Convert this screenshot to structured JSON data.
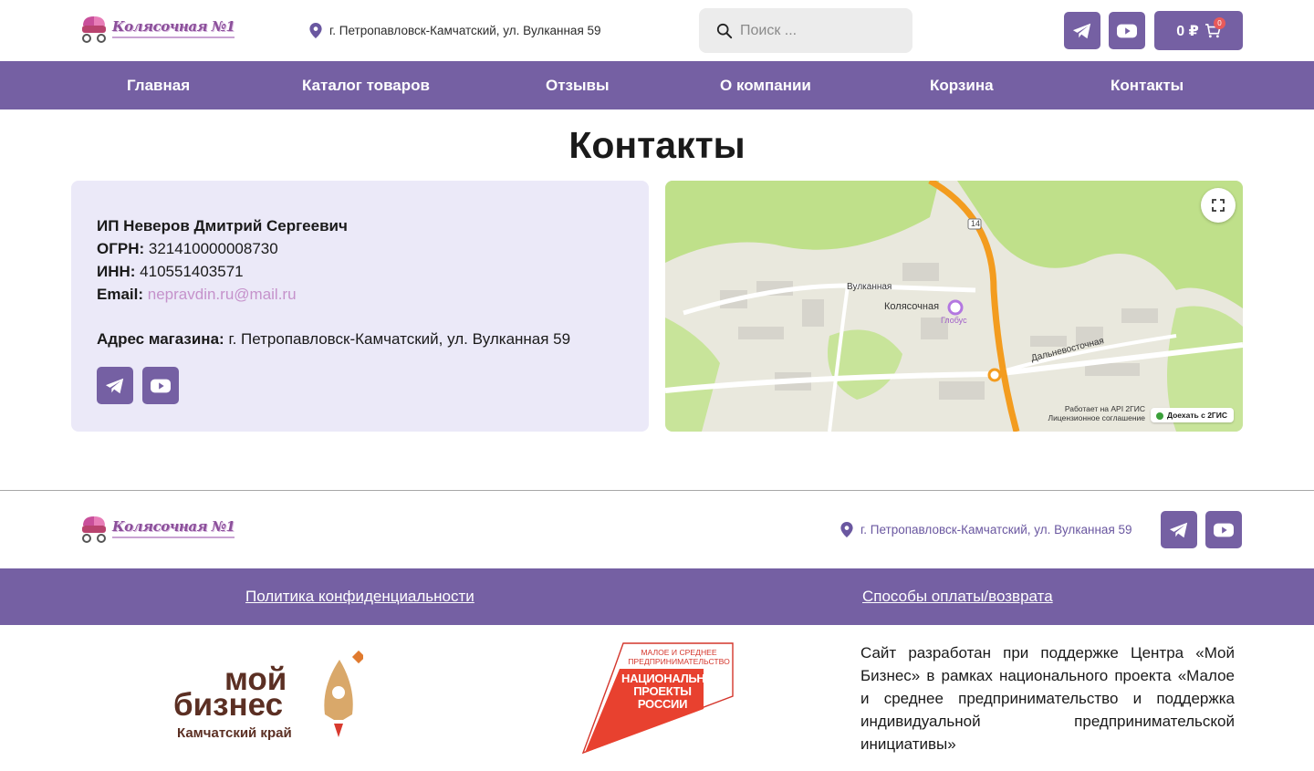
{
  "header": {
    "logo_text": "Колясочная №1",
    "address": "г. Петропавловск-Камчатский, ул. Вулканная 59",
    "search_placeholder": "Поиск ...",
    "cart": {
      "total": "0 ₽",
      "count": "0"
    }
  },
  "nav": {
    "items": [
      {
        "label": "Главная"
      },
      {
        "label": "Каталог товаров"
      },
      {
        "label": "Отзывы"
      },
      {
        "label": "О компании"
      },
      {
        "label": "Корзина"
      },
      {
        "label": "Контакты"
      }
    ]
  },
  "page": {
    "title": "Контакты"
  },
  "contacts": {
    "company": "ИП Неверов Дмитрий Сергеевич",
    "ogrn_label": "ОГРН:",
    "ogrn_value": "321410000008730",
    "inn_label": "ИНН:",
    "inn_value": "410551403571",
    "email_label": "Email:",
    "email_value": "nepravdin.ru@mail.ru",
    "address_label": "Адрес магазина:",
    "address_value": "г. Петропавловск-Камчатский, ул. Вулканная 59"
  },
  "map": {
    "place_name": "Колясочная",
    "poi": "Глобус",
    "street1": "Вулканная",
    "street2": "Дальневосточная",
    "road_number": "14",
    "api_line1": "Работает на API 2ГИС",
    "api_line2": "Лицензионное соглашение",
    "drive_label": "Доехать с 2ГИС"
  },
  "footer": {
    "logo_text": "Колясочная №1",
    "address": "г. Петропавловск-Камчатский, ул. Вулканная 59",
    "links": [
      {
        "label": "Политика конфиденциальности"
      },
      {
        "label": "Способы оплаты/возврата"
      }
    ],
    "partner1": {
      "line1": "мой",
      "line2": "бизнес",
      "line3": "Камчатский край"
    },
    "partner2": {
      "top": "МАЛОЕ И СРЕДНЕЕ ПРЕДПРИНИМАТЕЛЬСТВО",
      "main": "НАЦИОНАЛЬНЫЕ ПРОЕКТЫ РОССИИ"
    },
    "support_text": "Сайт разработан при поддержке Центра «Мой Бизнес» в рамках национального проекта «Малое и среднее предпринимательство и поддержка индивидуальной предпринимательской инициативы»"
  },
  "colors": {
    "brand_purple": "#7560a3",
    "contact_bg": "#ebe9f8",
    "email_link": "#c592cb",
    "road_orange": "#f39c1f"
  }
}
